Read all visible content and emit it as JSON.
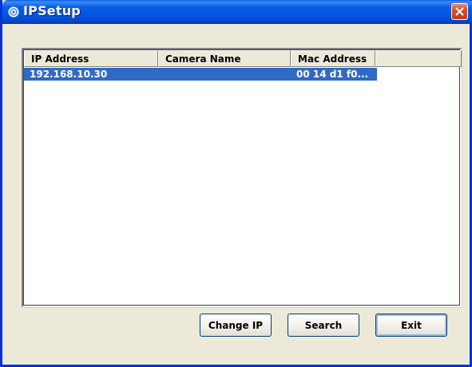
{
  "window": {
    "title": "IPSetup",
    "accent": "#0A5DE7",
    "close_color": "#D5502E"
  },
  "list": {
    "columns": [
      "IP Address",
      "Camera Name",
      "Mac Address",
      ""
    ],
    "rows": [
      {
        "ip": "192.168.10.30",
        "camera_name": "",
        "mac": "00 14 d1 f0...",
        "selected": true
      }
    ],
    "selection_color": "#316AC5"
  },
  "buttons": {
    "change_ip": "Change IP",
    "search": "Search",
    "exit": "Exit"
  },
  "icons": {
    "title_icon": "app-globe-icon",
    "close_icon": "close-icon"
  }
}
